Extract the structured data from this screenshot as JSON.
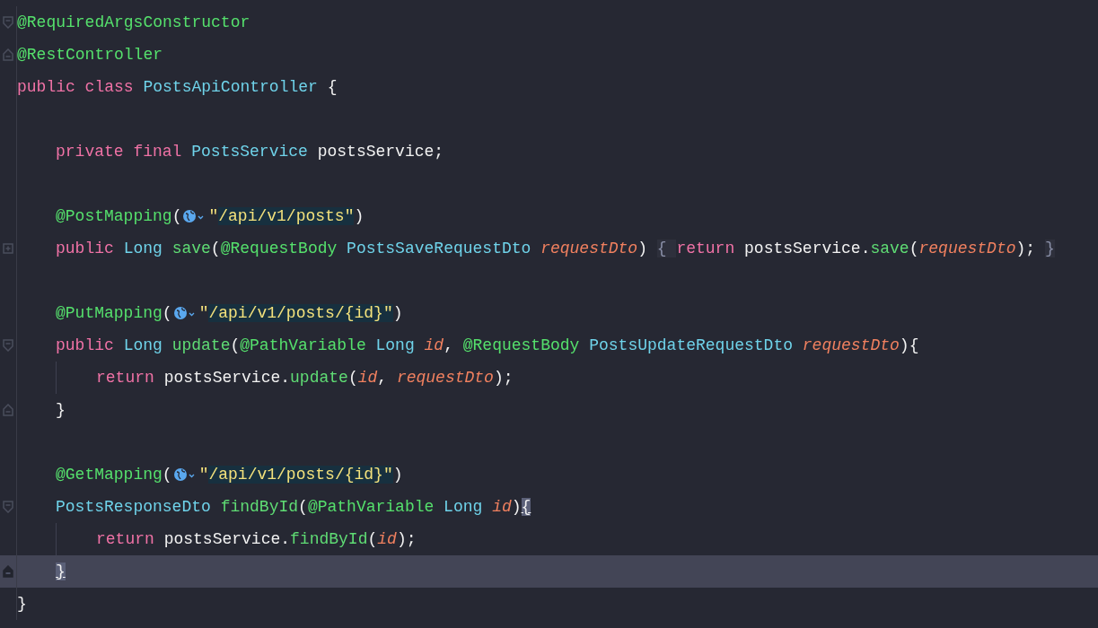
{
  "editor": {
    "lines": [
      {
        "kind": "opener",
        "current": false,
        "indented": false,
        "guide": false,
        "tokens": [
          {
            "kind": "annotation",
            "text": "@RequiredArgsConstructor"
          }
        ]
      },
      {
        "kind": "closer",
        "current": false,
        "indented": false,
        "guide": false,
        "tokens": [
          {
            "kind": "annotation",
            "text": "@RestController"
          }
        ]
      },
      {
        "kind": "plain",
        "current": false,
        "indented": false,
        "guide": false,
        "tokens": [
          {
            "kind": "keyword",
            "text": "public class "
          },
          {
            "kind": "type",
            "text": "PostsApiController "
          },
          {
            "kind": "plain",
            "text": "{"
          }
        ]
      },
      {
        "kind": "blank"
      },
      {
        "kind": "plain",
        "current": false,
        "indented": true,
        "guide": false,
        "tokens": [
          {
            "kind": "keyword",
            "text": "private final "
          },
          {
            "kind": "type",
            "text": "PostsService "
          },
          {
            "kind": "plain",
            "text": "postsService;"
          }
        ]
      },
      {
        "kind": "blank"
      },
      {
        "kind": "plain",
        "current": false,
        "indented": true,
        "guide": false,
        "tokens": [
          {
            "kind": "annotation",
            "text": "@PostMapping"
          },
          {
            "kind": "plain",
            "text": "("
          },
          {
            "kind": "globe"
          },
          {
            "kind": "string",
            "text": "\""
          },
          {
            "kind": "url",
            "text": "/api/v1/posts\""
          },
          {
            "kind": "plain",
            "text": ")"
          }
        ]
      },
      {
        "kind": "collapsed",
        "current": false,
        "indented": true,
        "guide": false,
        "tokens": [
          {
            "kind": "keyword",
            "text": "public "
          },
          {
            "kind": "type",
            "text": "Long "
          },
          {
            "kind": "method",
            "text": "save"
          },
          {
            "kind": "plain",
            "text": "("
          },
          {
            "kind": "annotation",
            "text": "@RequestBody "
          },
          {
            "kind": "type",
            "text": "PostsSaveRequestDto "
          },
          {
            "kind": "param",
            "text": "requestDto"
          },
          {
            "kind": "plain",
            "text": ") "
          },
          {
            "kind": "folded",
            "text": "{ "
          },
          {
            "kind": "keyword",
            "text": "return "
          },
          {
            "kind": "plain",
            "text": "postsService."
          },
          {
            "kind": "method",
            "text": "save"
          },
          {
            "kind": "plain",
            "text": "("
          },
          {
            "kind": "param",
            "text": "requestDto"
          },
          {
            "kind": "plain",
            "text": "); "
          },
          {
            "kind": "folded",
            "text": "}"
          }
        ]
      },
      {
        "kind": "blank"
      },
      {
        "kind": "plain",
        "current": false,
        "indented": true,
        "guide": false,
        "tokens": [
          {
            "kind": "annotation",
            "text": "@PutMapping"
          },
          {
            "kind": "plain",
            "text": "("
          },
          {
            "kind": "globe"
          },
          {
            "kind": "string",
            "text": "\""
          },
          {
            "kind": "url",
            "text": "/api/v1/posts/{id}\""
          },
          {
            "kind": "plain",
            "text": ")"
          }
        ]
      },
      {
        "kind": "opener",
        "current": false,
        "indented": true,
        "guide": false,
        "tokens": [
          {
            "kind": "keyword",
            "text": "public "
          },
          {
            "kind": "type",
            "text": "Long "
          },
          {
            "kind": "method",
            "text": "update"
          },
          {
            "kind": "plain",
            "text": "("
          },
          {
            "kind": "annotation",
            "text": "@PathVariable "
          },
          {
            "kind": "type",
            "text": "Long "
          },
          {
            "kind": "param",
            "text": "id"
          },
          {
            "kind": "plain",
            "text": ", "
          },
          {
            "kind": "annotation",
            "text": "@RequestBody "
          },
          {
            "kind": "type",
            "text": "PostsUpdateRequestDto "
          },
          {
            "kind": "param",
            "text": "requestDto"
          },
          {
            "kind": "plain",
            "text": "){"
          }
        ]
      },
      {
        "kind": "plain",
        "current": false,
        "indented": true,
        "guide": true,
        "tokens": [
          {
            "kind": "keyword",
            "text": "return "
          },
          {
            "kind": "plain",
            "text": "postsService."
          },
          {
            "kind": "method",
            "text": "update"
          },
          {
            "kind": "plain",
            "text": "("
          },
          {
            "kind": "param",
            "text": "id"
          },
          {
            "kind": "plain",
            "text": ", "
          },
          {
            "kind": "param",
            "text": "requestDto"
          },
          {
            "kind": "plain",
            "text": ");"
          }
        ]
      },
      {
        "kind": "closer",
        "current": false,
        "indented": true,
        "guide": false,
        "tokens": [
          {
            "kind": "plain",
            "text": "}"
          }
        ]
      },
      {
        "kind": "blank"
      },
      {
        "kind": "plain",
        "current": false,
        "indented": true,
        "guide": false,
        "tokens": [
          {
            "kind": "annotation",
            "text": "@GetMapping"
          },
          {
            "kind": "plain",
            "text": "("
          },
          {
            "kind": "globe"
          },
          {
            "kind": "string",
            "text": "\""
          },
          {
            "kind": "url",
            "text": "/api/v1/posts/{id}\""
          },
          {
            "kind": "plain",
            "text": ")"
          }
        ]
      },
      {
        "kind": "opener",
        "current": false,
        "indented": true,
        "guide": false,
        "tokens": [
          {
            "kind": "type",
            "text": "PostsResponseDto "
          },
          {
            "kind": "method",
            "text": "findById"
          },
          {
            "kind": "plain",
            "text": "("
          },
          {
            "kind": "annotation",
            "text": "@PathVariable "
          },
          {
            "kind": "type",
            "text": "Long "
          },
          {
            "kind": "param",
            "text": "id"
          },
          {
            "kind": "plain",
            "text": ")"
          },
          {
            "kind": "match",
            "text": "{"
          }
        ]
      },
      {
        "kind": "plain",
        "current": false,
        "indented": true,
        "guide": true,
        "tokens": [
          {
            "kind": "keyword",
            "text": "return "
          },
          {
            "kind": "plain",
            "text": "postsService."
          },
          {
            "kind": "method",
            "text": "findById"
          },
          {
            "kind": "plain",
            "text": "("
          },
          {
            "kind": "param",
            "text": "id"
          },
          {
            "kind": "plain",
            "text": ");"
          }
        ]
      },
      {
        "kind": "closer",
        "current": true,
        "indented": true,
        "guide": false,
        "tokens": [
          {
            "kind": "match",
            "text": "}"
          }
        ]
      },
      {
        "kind": "plain",
        "current": false,
        "indented": false,
        "guide": false,
        "tokens": [
          {
            "kind": "plain",
            "text": "}"
          }
        ]
      }
    ]
  }
}
